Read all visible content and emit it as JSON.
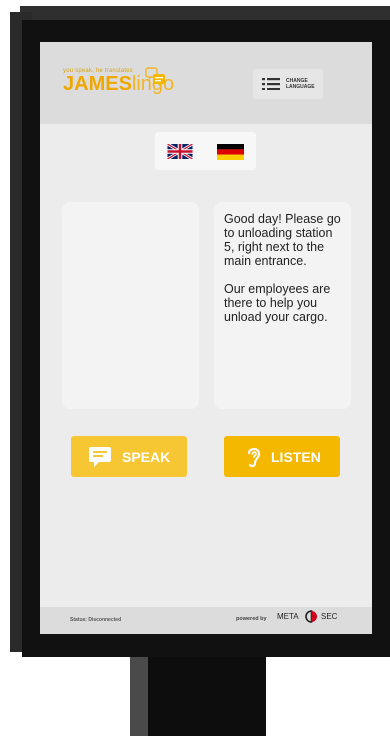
{
  "header": {
    "tagline": "you speak, he translates",
    "logo_bold": "JAMES",
    "logo_light": "lingo",
    "change_language": "CHANGE\nLANGUAGE"
  },
  "flags": [
    {
      "name": "uk-flag"
    },
    {
      "name": "german-flag"
    }
  ],
  "panels": {
    "left_text": "",
    "right_text": "Good day! Please go to unloading station 5, right next to the main entrance.\n\nOur employees are there to help you unload your cargo."
  },
  "buttons": {
    "speak": "SPEAK",
    "listen": "LISTEN"
  },
  "footer": {
    "status": "Status: Disconnected",
    "powered": "powered by",
    "brand_left": "META",
    "brand_right": "SEC"
  },
  "colors": {
    "accent": "#f5b800",
    "accent_light": "#f6c633",
    "screen_bg": "#ececec",
    "casing": "#111111"
  }
}
